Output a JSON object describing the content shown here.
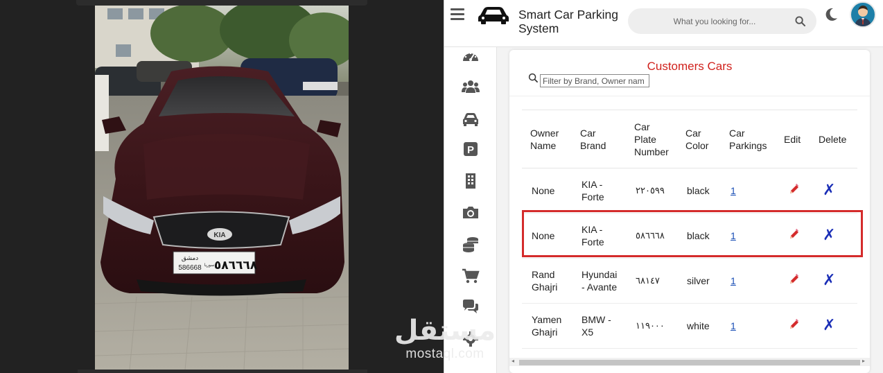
{
  "app": {
    "title": "Smart Car Parking System",
    "search_placeholder": "What you looking for..."
  },
  "sidebar": {
    "items": [
      {
        "icon": "dashboard-icon"
      },
      {
        "icon": "users-icon"
      },
      {
        "icon": "car-icon"
      },
      {
        "icon": "parking-icon"
      },
      {
        "icon": "building-icon"
      },
      {
        "icon": "camera-icon"
      },
      {
        "icon": "coins-icon"
      },
      {
        "icon": "cart-icon"
      },
      {
        "icon": "chat-icon"
      },
      {
        "icon": "gear-icon"
      }
    ]
  },
  "card": {
    "title": "Customers Cars",
    "filter_placeholder": "Filter by Brand, Owner nam"
  },
  "table": {
    "headers": [
      "Owner Name",
      "Car Brand",
      "Car Plate Number",
      "Car Color",
      "Car Parkings",
      "Edit",
      "Delete"
    ],
    "rows": [
      {
        "owner": "None",
        "brand": "KIA - Forte",
        "plate": "٢٢٠٥٩٩",
        "color": "black",
        "parkings": "1",
        "delete": "✗"
      },
      {
        "owner": "None",
        "brand": "KIA - Forte",
        "plate": "٥٨٦٦٦٨",
        "color": "black",
        "parkings": "1",
        "delete": "✗"
      },
      {
        "owner": "Rand Ghajri",
        "brand": "Hyundai - Avante",
        "plate": "٦٨١٤٧",
        "color": "silver",
        "parkings": "1",
        "delete": "✗"
      },
      {
        "owner": "Yamen Ghajri",
        "brand": "BMW - X5",
        "plate": "١١٩٠٠٠",
        "color": "white",
        "parkings": "1",
        "delete": "✗"
      }
    ]
  },
  "photo": {
    "plate_latin": "586668",
    "plate_arabic": "٥٨٦٦٦٨",
    "plate_city": "دمشق",
    "plate_side": "سوريا",
    "grille_logo": "KIA"
  },
  "watermark": {
    "arabic": "مستقل",
    "latin": "mostaql.com"
  },
  "colors": {
    "title_red": "#d0211c",
    "highlight_red": "#d42b2b",
    "delete_blue": "#1b2fb7",
    "link_blue": "#1a4fb6"
  }
}
